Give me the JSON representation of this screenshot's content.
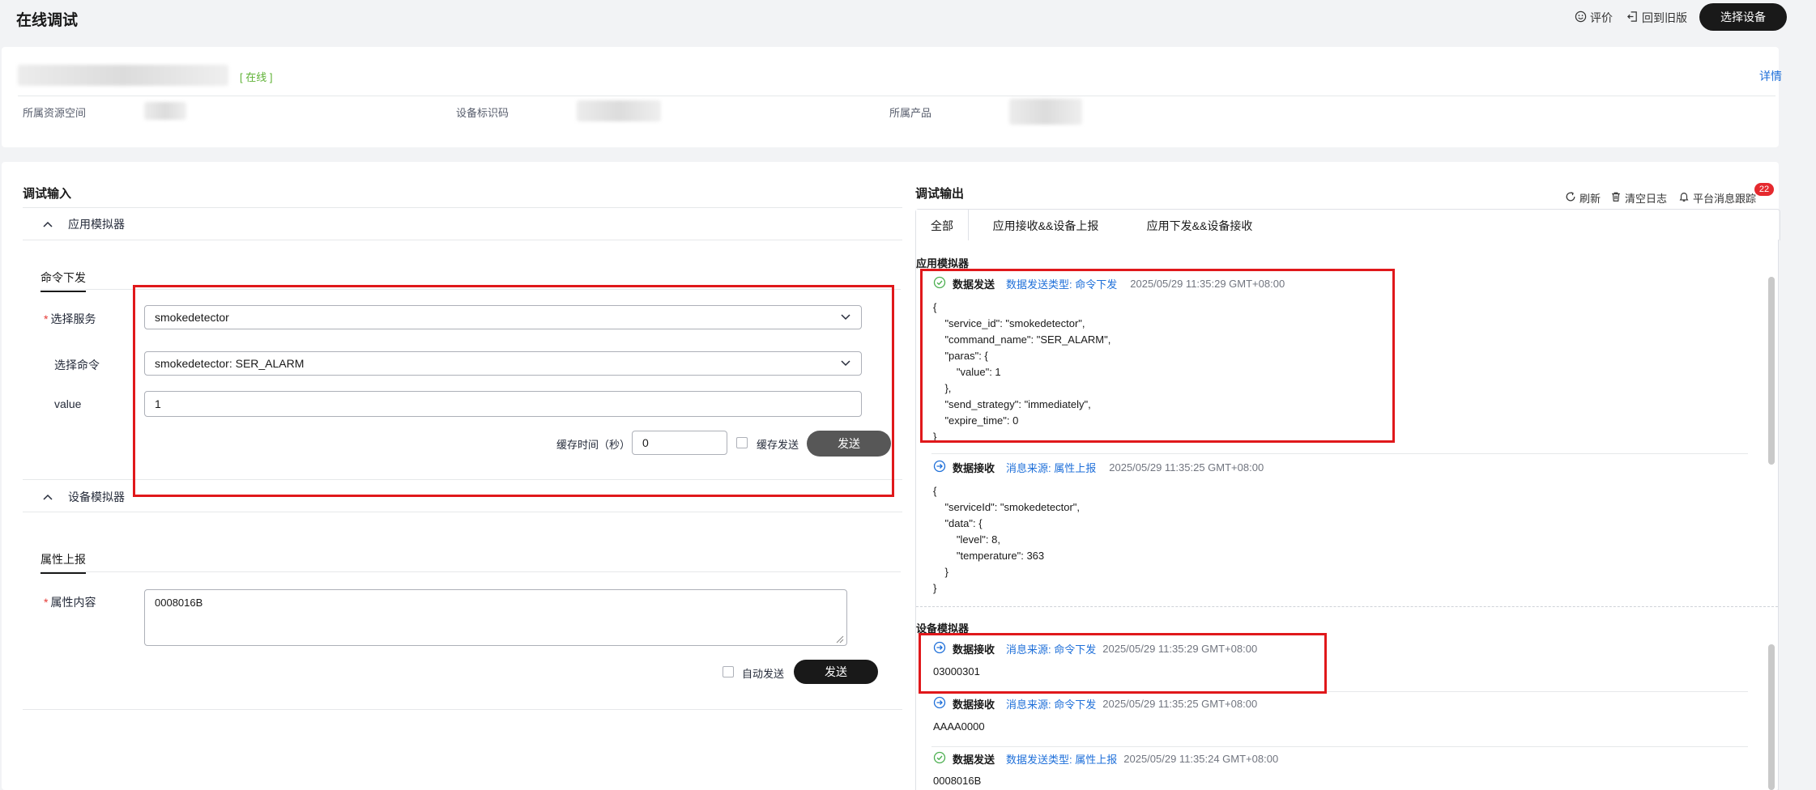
{
  "header": {
    "title": "在线调试",
    "rate_label": "评价",
    "back_old_label": "回到旧版",
    "select_device_label": "选择设备"
  },
  "device": {
    "status": "[ 在线 ]",
    "details_link": "详情",
    "space_label": "所属资源空间",
    "id_label": "设备标识码",
    "product_label": "所属产品"
  },
  "input_panel": {
    "title": "调试输入",
    "app_sim": {
      "title": "应用模拟器",
      "tab": "命令下发",
      "service_label": "选择服务",
      "service_value": "smokedetector",
      "command_label": "选择命令",
      "command_value": "smokedetector: SER_ALARM",
      "value_label": "value",
      "value_value": "1",
      "cache_time_label": "缓存时间（秒）",
      "cache_time_value": "0",
      "cache_send_label": "缓存发送",
      "send_label": "发送"
    },
    "dev_sim": {
      "title": "设备模拟器",
      "tab": "属性上报",
      "content_label": "属性内容",
      "content_value": "0008016B",
      "auto_send_label": "自动发送",
      "send_label": "发送"
    }
  },
  "output_panel": {
    "title": "调试输出",
    "refresh_label": "刷新",
    "clear_label": "清空日志",
    "trace_label": "平台消息跟踪",
    "trace_badge": "22",
    "tabs": [
      "全部",
      "应用接收&&设备上报",
      "应用下发&&设备接收"
    ],
    "app_section_title": "应用模拟器",
    "dev_section_title": "设备模拟器",
    "app_logs": [
      {
        "kind": "数据发送",
        "source": "数据发送类型: 命令下发",
        "time": "2025/05/29 11:35:29 GMT+08:00",
        "body": "{\n    \"service_id\": \"smokedetector\",\n    \"command_name\": \"SER_ALARM\",\n    \"paras\": {\n        \"value\": 1\n    },\n    \"send_strategy\": \"immediately\",\n    \"expire_time\": 0\n}"
      },
      {
        "kind": "数据接收",
        "source": "消息来源: 属性上报",
        "time": "2025/05/29 11:35:25 GMT+08:00",
        "body": "{\n    \"serviceId\": \"smokedetector\",\n    \"data\": {\n        \"level\": 8,\n        \"temperature\": 363\n    }\n}"
      }
    ],
    "dev_logs": [
      {
        "kind": "数据接收",
        "source": "消息来源: 命令下发",
        "time": "2025/05/29 11:35:29 GMT+08:00",
        "body": "03000301"
      },
      {
        "kind": "数据接收",
        "source": "消息来源: 命令下发",
        "time": "2025/05/29 11:35:25 GMT+08:00",
        "body": "AAAA0000"
      },
      {
        "kind": "数据发送",
        "source": "数据发送类型: 属性上报",
        "time": "2025/05/29 11:35:24 GMT+08:00",
        "body": "0008016B"
      }
    ]
  },
  "colors": {
    "accent_blue": "#1e6fd9",
    "online_green": "#5fb236",
    "highlight_red": "#e0181b",
    "dark_button": "#191919"
  }
}
